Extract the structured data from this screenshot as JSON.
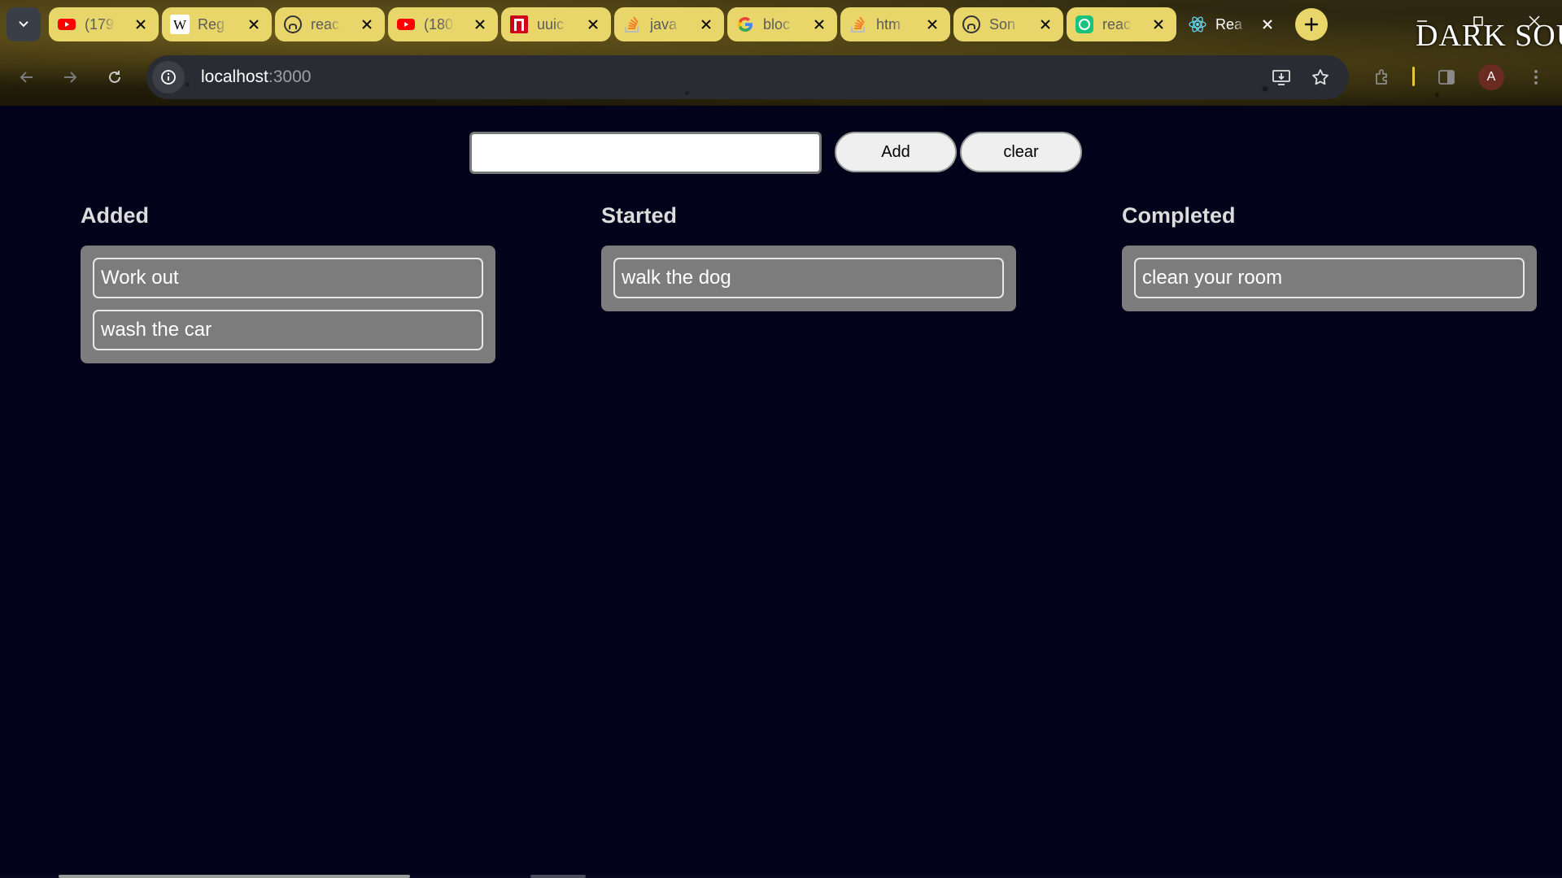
{
  "browser": {
    "tabs": [
      {
        "title": "(179",
        "icon": "youtube-icon"
      },
      {
        "title": "Reg",
        "icon": "wikipedia-icon"
      },
      {
        "title": "reac",
        "icon": "github-icon"
      },
      {
        "title": "(180",
        "icon": "youtube-icon"
      },
      {
        "title": "uuic",
        "icon": "dictionary-icon"
      },
      {
        "title": "java",
        "icon": "stackoverflow-icon"
      },
      {
        "title": "bloc",
        "icon": "google-icon"
      },
      {
        "title": "htm",
        "icon": "stackoverflow-icon"
      },
      {
        "title": "Son",
        "icon": "github-icon"
      },
      {
        "title": "reac",
        "icon": "chatgpt-icon"
      },
      {
        "title": "Rea",
        "icon": "react-icon",
        "active": true
      }
    ],
    "theme_banner": "DARK SOU",
    "url_host": "localhost",
    "url_port": ":3000",
    "profile_initial": "A",
    "colors": {
      "tab": "#e9d66b",
      "omnibox": "#2a2c33",
      "page_background": "#02021a",
      "card_list": "#7c7c7c"
    }
  },
  "app": {
    "input_value": "",
    "add_label": "Add",
    "clear_label": "clear",
    "columns": [
      {
        "title": "Added",
        "items": [
          "Work out",
          "wash the car"
        ]
      },
      {
        "title": "Started",
        "items": [
          "walk the dog"
        ]
      },
      {
        "title": "Completed",
        "items": [
          "clean your room"
        ]
      }
    ]
  }
}
